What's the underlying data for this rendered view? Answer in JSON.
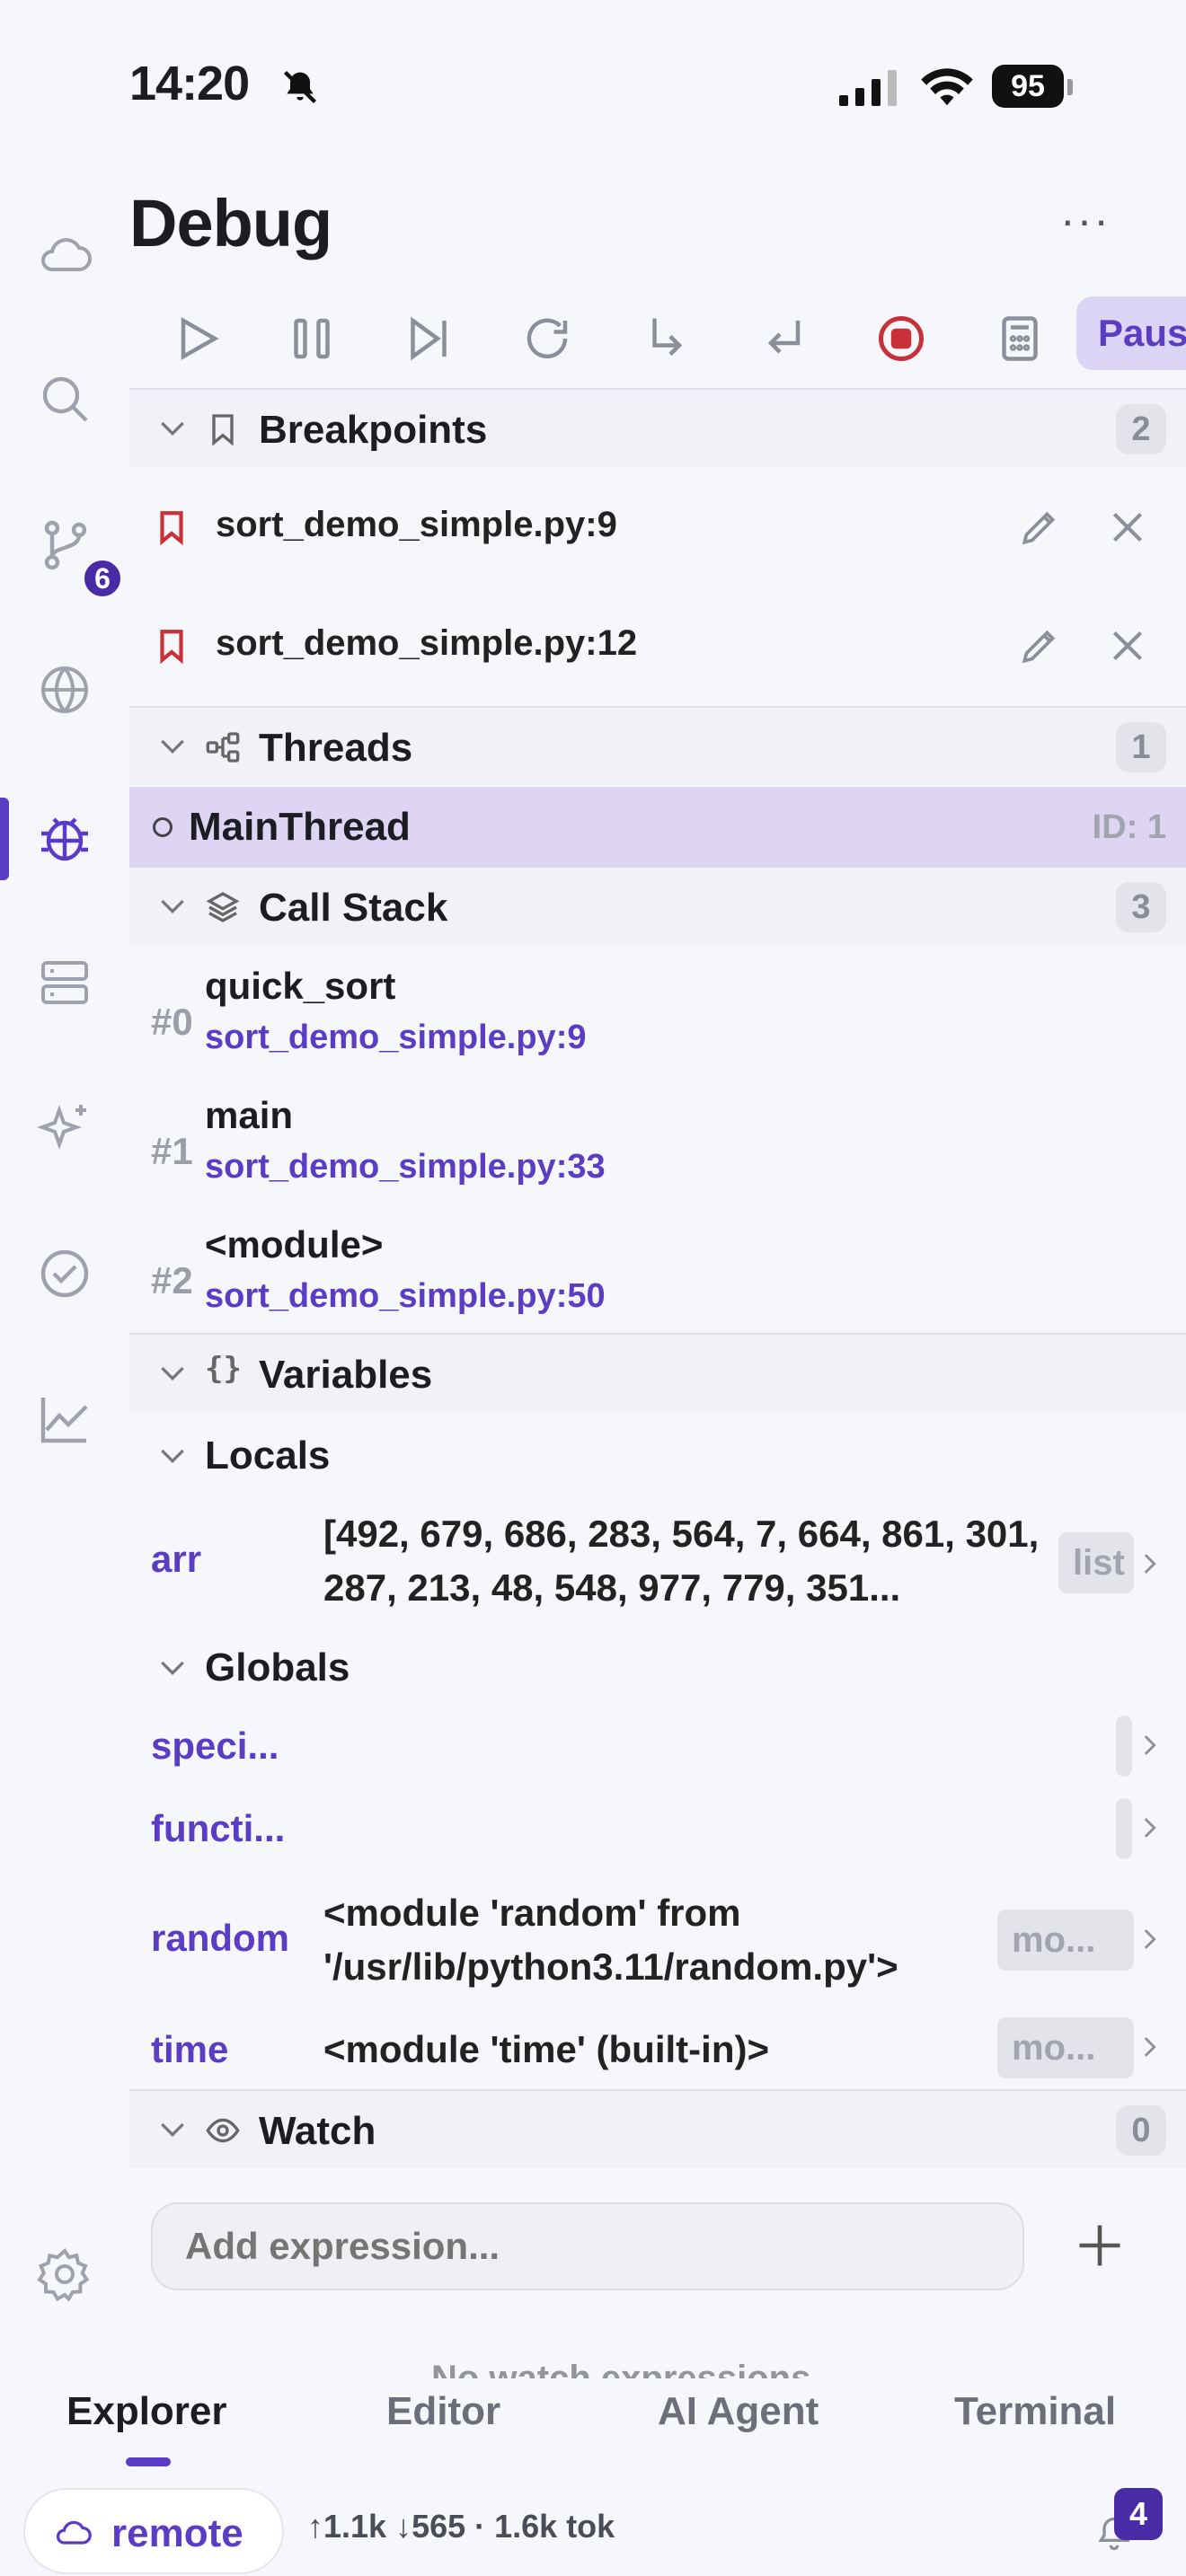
{
  "status_bar": {
    "time": "14:20",
    "battery": "95"
  },
  "rail": {
    "items": [
      "cloud",
      "search",
      "source-control",
      "globe",
      "debug",
      "server",
      "ai-sparkle",
      "tasks",
      "stats",
      "settings"
    ],
    "active": "debug",
    "scm_badge": "6"
  },
  "panel": {
    "title": "Debug",
    "more": "···",
    "pause_label": "Pause",
    "accent_color": "#5b3cc4"
  },
  "breakpoints": {
    "title": "Breakpoints",
    "count": "2",
    "items": [
      "sort_demo_simple.py:9",
      "sort_demo_simple.py:12"
    ]
  },
  "threads": {
    "title": "Threads",
    "count": "1",
    "items": [
      {
        "name": "MainThread",
        "id": "ID: 1"
      }
    ]
  },
  "call_stack": {
    "title": "Call Stack",
    "count": "3",
    "frames": [
      {
        "index": "#0",
        "name": "quick_sort",
        "location": "sort_demo_simple.py:9"
      },
      {
        "index": "#1",
        "name": "main",
        "location": "sort_demo_simple.py:33"
      },
      {
        "index": "#2",
        "name": "<module>",
        "location": "sort_demo_simple.py:50"
      }
    ]
  },
  "variables": {
    "title": "Variables",
    "locals_title": "Locals",
    "locals": [
      {
        "name": "arr",
        "value": "[492, 679, 686, 283, 564, 7, 664, 861, 301, 287, 213, 48, 548, 977, 779, 351...",
        "type": "list"
      }
    ],
    "globals_title": "Globals",
    "globals": [
      {
        "name": "speci...",
        "value": "",
        "type": ""
      },
      {
        "name": "functi...",
        "value": "",
        "type": ""
      },
      {
        "name": "random",
        "value": "<module 'random' from '/usr/lib/python3.11/random.py'>",
        "type": "mo..."
      },
      {
        "name": "time",
        "value": "<module 'time' (built-in)>",
        "type": "mo..."
      }
    ]
  },
  "watch": {
    "title": "Watch",
    "count": "0",
    "placeholder": "Add expression..."
  },
  "tabs": {
    "items": [
      "Explorer",
      "Editor",
      "AI Agent",
      "Terminal"
    ],
    "active": "Explorer"
  },
  "footer": {
    "remote_label": "remote",
    "tokens": "↑1.1k ↓565 · 1.6k tok",
    "notif_count": "4"
  }
}
